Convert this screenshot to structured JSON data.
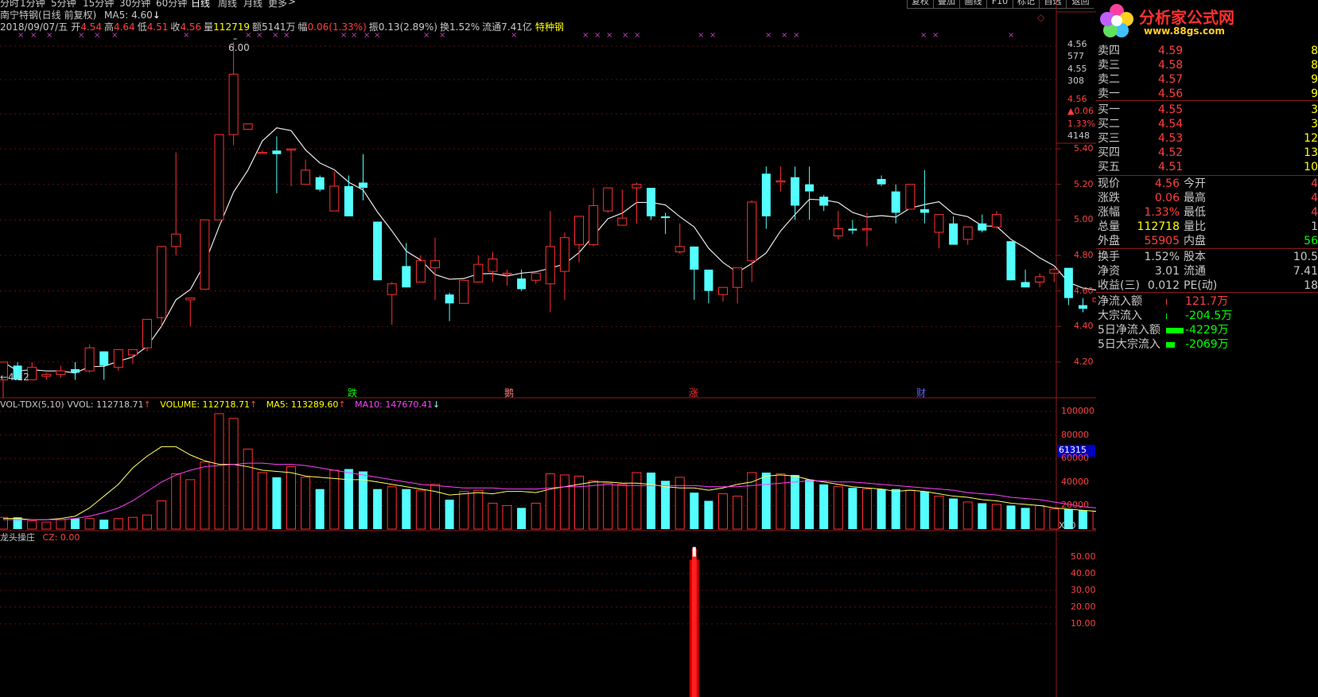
{
  "toolbar": {
    "periods": [
      "分时",
      "1分钟",
      "5分钟",
      "15分钟",
      "30分钟",
      "60分钟",
      "日线",
      "周线",
      "月线",
      "更多"
    ],
    "active_period": "日线",
    "more_arrow": ">",
    "buttons": [
      "复权",
      "叠加",
      "画线",
      "F10",
      "标记",
      "自选",
      "返回"
    ]
  },
  "header": {
    "title": "南宁特钢(日线 前复权)",
    "ma5_label": "MA5: 4.60",
    "ma5_arrow": "↓",
    "date": "2018/09/07/五",
    "quote_items": [
      {
        "label": "开",
        "value": "4.54",
        "color": "#ff4040"
      },
      {
        "label": "高",
        "value": "4.64",
        "color": "#ff4040"
      },
      {
        "label": "低",
        "value": "4.51",
        "color": "#ff4040"
      },
      {
        "label": "收",
        "value": "4.56",
        "color": "#ff4040"
      },
      {
        "label": "量",
        "value": "112719",
        "color": "#ffff00"
      },
      {
        "label": "额",
        "value": "5141万",
        "color": "#c8c8c8"
      },
      {
        "label": "幅",
        "value": "0.06(1.33%)",
        "color": "#ff4040"
      },
      {
        "label": "振",
        "value": "0.13(2.89%)",
        "color": "#c8c8c8"
      },
      {
        "label": "换",
        "value": "1.52%",
        "color": "#c8c8c8"
      },
      {
        "label": "流通",
        "value": "7.41亿",
        "color": "#c8c8c8"
      }
    ],
    "concept": "特种钢"
  },
  "price_axis": {
    "ticks": [
      "5.40",
      "5.20",
      "5.00",
      "4.80",
      "4.60",
      "4.40",
      "4.20"
    ],
    "top_info": [
      "4.56",
      "577",
      "4.55",
      "308",
      "4.56",
      "▲0.06",
      "1.33%",
      "4148"
    ]
  },
  "annotations": {
    "high": "6.00",
    "low": "←4.12",
    "events": [
      "跌",
      "鹅",
      "涨",
      "财"
    ]
  },
  "volume_panel": {
    "indicator": "VOL-TDX(5,10)",
    "vvol": "VVOL: 112718.71",
    "volume": "VOLUME: 112718.71",
    "ma5": "MA5: 113289.60",
    "ma10": "MA10: 147670.41",
    "ticks": [
      "100000",
      "80000",
      "60000",
      "40000",
      "20000"
    ],
    "current_value": "61315",
    "multiplier": "X10"
  },
  "indicator_panel": {
    "name": "龙头操庄",
    "cz": "CZ: 0.00",
    "ticks": [
      "50.00",
      "40.00",
      "30.00",
      "20.00",
      "10.00"
    ]
  },
  "right_panel": {
    "logo_text": "分析家公式网",
    "logo_url": "www.88gs.com",
    "sells": [
      {
        "label": "卖四",
        "price": "4.59",
        "vol": "8"
      },
      {
        "label": "卖三",
        "price": "4.58",
        "vol": "8"
      },
      {
        "label": "卖二",
        "price": "4.57",
        "vol": "9"
      },
      {
        "label": "卖一",
        "price": "4.56",
        "vol": "9"
      }
    ],
    "buys": [
      {
        "label": "买一",
        "price": "4.55",
        "vol": "3"
      },
      {
        "label": "买二",
        "price": "4.54",
        "vol": "3"
      },
      {
        "label": "买三",
        "price": "4.53",
        "vol": "12"
      },
      {
        "label": "买四",
        "price": "4.52",
        "vol": "13"
      },
      {
        "label": "买五",
        "price": "4.51",
        "vol": "10"
      }
    ],
    "stats": [
      {
        "l1": "现价",
        "v1": "4.56",
        "c1": "#ff4040",
        "l2": "今开",
        "v2": "4",
        "c2": "#ff4040"
      },
      {
        "l1": "涨跌",
        "v1": "0.06",
        "c1": "#ff4040",
        "l2": "最高",
        "v2": "4",
        "c2": "#ff4040"
      },
      {
        "l1": "涨幅",
        "v1": "1.33%",
        "c1": "#ff4040",
        "l2": "最低",
        "v2": "4",
        "c2": "#ff4040"
      },
      {
        "l1": "总量",
        "v1": "112718",
        "c1": "#ffff00",
        "l2": "量比",
        "v2": "1",
        "c2": "#c8c8c8"
      },
      {
        "l1": "外盘",
        "v1": "55905",
        "c1": "#ff4040",
        "l2": "内盘",
        "v2": "56",
        "c2": "#00ff00"
      }
    ],
    "stats2": [
      {
        "l1": "换手",
        "v1": "1.52%",
        "l2": "股本",
        "v2": "10.5"
      },
      {
        "l1": "净资",
        "v1": "3.01",
        "l2": "流通",
        "v2": "7.41"
      },
      {
        "l1": "收益(三)",
        "v1": "0.012",
        "l2": "PE(动)",
        "v2": "18"
      }
    ],
    "flows": [
      {
        "label": "净流入额",
        "value": "121.7万",
        "color": "#ff4040",
        "bar": 0.01
      },
      {
        "label": "大宗流入",
        "value": "-204.5万",
        "color": "#00ff00",
        "bar": 0.01
      },
      {
        "label": "5日净流入额",
        "value": "-4229万",
        "color": "#00ff00",
        "bar": 1.0
      },
      {
        "label": "5日大宗流入",
        "value": "-2069万",
        "color": "#00ff00",
        "bar": 0.5
      }
    ]
  },
  "chart_data": {
    "type": "candlestick",
    "price_range": [
      4.12,
      6.0
    ],
    "candles": [
      [
        4.1,
        4.2,
        4.0,
        4.2
      ],
      [
        4.18,
        4.2,
        4.1,
        4.1
      ],
      [
        4.1,
        4.2,
        4.1,
        4.17
      ],
      [
        4.12,
        4.14,
        4.1,
        4.13
      ],
      [
        4.13,
        4.18,
        4.11,
        4.15
      ],
      [
        4.16,
        4.2,
        4.1,
        4.14
      ],
      [
        4.15,
        4.3,
        4.14,
        4.28
      ],
      [
        4.26,
        4.26,
        4.1,
        4.18
      ],
      [
        4.17,
        4.27,
        4.15,
        4.27
      ],
      [
        4.24,
        4.26,
        4.19,
        4.27
      ],
      [
        4.28,
        4.44,
        4.26,
        4.44
      ],
      [
        4.45,
        4.85,
        4.4,
        4.85
      ],
      [
        4.85,
        5.38,
        4.8,
        4.92
      ],
      [
        4.55,
        4.55,
        4.4,
        4.56
      ],
      [
        4.61,
        5.0,
        4.61,
        5.0
      ],
      [
        5.0,
        5.48,
        5.0,
        5.48
      ],
      [
        5.48,
        6.0,
        5.42,
        5.82
      ],
      [
        5.51,
        5.54,
        5.51,
        5.54
      ],
      [
        5.38,
        5.39,
        5.38,
        5.38
      ],
      [
        5.39,
        5.47,
        5.15,
        5.37
      ],
      [
        5.4,
        5.4,
        5.19,
        5.4
      ],
      [
        5.2,
        5.34,
        5.2,
        5.28
      ],
      [
        5.24,
        5.25,
        5.16,
        5.17
      ],
      [
        5.05,
        5.27,
        5.05,
        5.19
      ],
      [
        5.19,
        5.25,
        5.02,
        5.02
      ],
      [
        5.21,
        5.37,
        5.11,
        5.18
      ],
      [
        4.99,
        4.99,
        4.66,
        4.66
      ],
      [
        4.58,
        4.65,
        4.41,
        4.64
      ],
      [
        4.74,
        4.87,
        4.62,
        4.62
      ],
      [
        4.65,
        4.8,
        4.68,
        4.77
      ],
      [
        4.73,
        4.9,
        4.55,
        4.77
      ],
      [
        4.58,
        4.59,
        4.43,
        4.53
      ],
      [
        4.53,
        4.66,
        4.54,
        4.66
      ],
      [
        4.65,
        4.8,
        4.65,
        4.75
      ],
      [
        4.71,
        4.82,
        4.65,
        4.78
      ],
      [
        4.7,
        4.72,
        4.63,
        4.7
      ],
      [
        4.67,
        4.72,
        4.6,
        4.61
      ],
      [
        4.66,
        4.7,
        4.64,
        4.7
      ],
      [
        4.64,
        5.05,
        4.48,
        4.85
      ],
      [
        4.71,
        4.93,
        4.55,
        4.9
      ],
      [
        4.86,
        5.01,
        4.76,
        5.02
      ],
      [
        4.86,
        5.18,
        4.85,
        5.08
      ],
      [
        5.05,
        5.18,
        5.04,
        5.18
      ],
      [
        4.97,
        5.17,
        4.97,
        5.01
      ],
      [
        5.18,
        5.21,
        4.98,
        5.2
      ],
      [
        5.18,
        5.17,
        5.0,
        5.02
      ],
      [
        5.02,
        5.04,
        4.92,
        5.01
      ],
      [
        4.82,
        4.98,
        4.81,
        4.85
      ],
      [
        4.85,
        4.85,
        4.55,
        4.72
      ],
      [
        4.72,
        4.72,
        4.53,
        4.6
      ],
      [
        4.58,
        4.62,
        4.54,
        4.62
      ],
      [
        4.62,
        4.66,
        4.53,
        4.73
      ],
      [
        4.77,
        5.11,
        4.65,
        5.1
      ],
      [
        5.26,
        5.3,
        4.95,
        5.02
      ],
      [
        5.22,
        5.3,
        5.16,
        5.22
      ],
      [
        5.24,
        5.3,
        5.0,
        5.08
      ],
      [
        5.2,
        5.3,
        5.0,
        5.16
      ],
      [
        5.13,
        5.14,
        5.05,
        5.08
      ],
      [
        4.91,
        5.05,
        4.89,
        4.95
      ],
      [
        4.95,
        5.0,
        4.92,
        4.94
      ],
      [
        4.95,
        5.04,
        4.85,
        4.95
      ],
      [
        5.23,
        5.25,
        5.19,
        5.2
      ],
      [
        5.16,
        5.2,
        4.98,
        5.04
      ],
      [
        5.06,
        5.12,
        5.06,
        5.2
      ],
      [
        5.06,
        5.28,
        4.98,
        5.04
      ],
      [
        4.93,
        5.02,
        4.84,
        5.03
      ],
      [
        4.98,
        5.02,
        4.93,
        4.86
      ],
      [
        4.89,
        4.95,
        4.86,
        4.96
      ],
      [
        4.98,
        5.03,
        4.93,
        4.94
      ],
      [
        4.96,
        5.05,
        4.95,
        5.03
      ],
      [
        4.88,
        4.88,
        4.66,
        4.66
      ],
      [
        4.65,
        4.72,
        4.62,
        4.62
      ],
      [
        4.65,
        4.7,
        4.62,
        4.68
      ],
      [
        4.7,
        4.73,
        4.65,
        4.72
      ],
      [
        4.73,
        4.73,
        4.52,
        4.56
      ],
      [
        4.52,
        4.56,
        4.48,
        4.5
      ],
      [
        4.54,
        4.64,
        4.51,
        4.56
      ]
    ],
    "volume": [
      10,
      10,
      7,
      6,
      8,
      9,
      9,
      8,
      9,
      10,
      12,
      24,
      47,
      42,
      57,
      98,
      94,
      68,
      48,
      44,
      53,
      44,
      34,
      50,
      51,
      49,
      34,
      36,
      34,
      33,
      38,
      25,
      32,
      33,
      22,
      20,
      18,
      22,
      47,
      46,
      45,
      41,
      39,
      38,
      48,
      48,
      41,
      44,
      31,
      24,
      30,
      28,
      48,
      48,
      47,
      46,
      42,
      38,
      36,
      35,
      34,
      34,
      34,
      33,
      32,
      28,
      26,
      23,
      22,
      21,
      20,
      18,
      20,
      17,
      17,
      16,
      15
    ],
    "vol_ma5_line": [
      9,
      9,
      8,
      8,
      9,
      11,
      18,
      28,
      38,
      52,
      62,
      70,
      70,
      63,
      58,
      55,
      55,
      53,
      50,
      49,
      48,
      45,
      44,
      43,
      42,
      42,
      40,
      38,
      36,
      34,
      32,
      29,
      30,
      31,
      30,
      32,
      32,
      31,
      34,
      36,
      38,
      40,
      40,
      39,
      39,
      38,
      36,
      35,
      35,
      33,
      35,
      38,
      40,
      45,
      46,
      45,
      42,
      40,
      38,
      36,
      35,
      34,
      32,
      33,
      32,
      30,
      28,
      27,
      25,
      24,
      22,
      21,
      20,
      18,
      17,
      16,
      15
    ],
    "vol_ma10_line": [
      8,
      8,
      8,
      8,
      8,
      9,
      11,
      14,
      18,
      24,
      32,
      40,
      46,
      50,
      53,
      54,
      55,
      56,
      56,
      55,
      55,
      54,
      52,
      50,
      48,
      46,
      44,
      42,
      40,
      38,
      37,
      36,
      35,
      35,
      35,
      34,
      34,
      34,
      35,
      36,
      36,
      37,
      38,
      37,
      37,
      37,
      37,
      37,
      37,
      36,
      36,
      36,
      37,
      38,
      39,
      40,
      41,
      41,
      40,
      40,
      39,
      38,
      37,
      36,
      35,
      34,
      33,
      31,
      30,
      29,
      27,
      26,
      25,
      23,
      21,
      19,
      18
    ],
    "indicator": {
      "index": 48,
      "value": 55
    }
  }
}
